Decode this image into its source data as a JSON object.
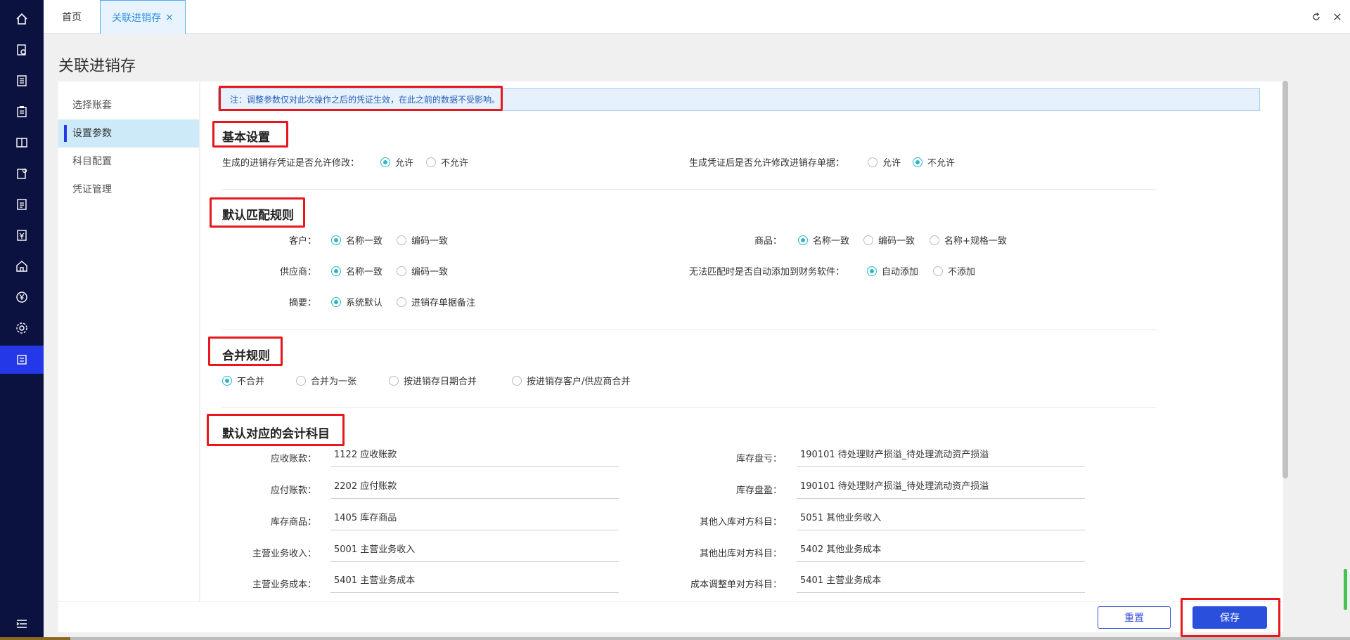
{
  "tabs": {
    "home": "首页",
    "active": "关联进销存",
    "active_close": "×"
  },
  "toolbar": {
    "refresh_icon": "refresh-icon",
    "close_icon": "close-icon"
  },
  "page": {
    "title": "关联进销存"
  },
  "sidebar_nav": {
    "items": [
      "选择账套",
      "设置参数",
      "科目配置",
      "凭证管理"
    ],
    "active_index": 1
  },
  "notice": "注：调整参数仅对此次操作之后的凭证生效，在此之前的数据不受影响。",
  "basic": {
    "title": "基本设置",
    "q1": {
      "label": "生成的进销存凭证是否允许修改：",
      "options": [
        "允许",
        "不允许"
      ],
      "selected": "允许"
    },
    "q2": {
      "label": "生成凭证后是否允许修改进销存单据：",
      "options": [
        "允许",
        "不允许"
      ],
      "selected": "不允许"
    }
  },
  "match": {
    "title": "默认匹配规则",
    "customer": {
      "label": "客户：",
      "options": [
        "名称一致",
        "编码一致"
      ],
      "selected": "名称一致"
    },
    "goods": {
      "label": "商品：",
      "options": [
        "名称一致",
        "编码一致",
        "名称+规格一致"
      ],
      "selected": "名称一致"
    },
    "supplier": {
      "label": "供应商：",
      "options": [
        "名称一致",
        "编码一致"
      ],
      "selected": "名称一致"
    },
    "auto_add": {
      "label": "无法匹配时是否自动添加到财务软件：",
      "options": [
        "自动添加",
        "不添加"
      ],
      "selected": "自动添加"
    },
    "summary": {
      "label": "摘要：",
      "options": [
        "系统默认",
        "进销存单据备注"
      ],
      "selected": "系统默认"
    }
  },
  "merge": {
    "title": "合并规则",
    "options": [
      "不合并",
      "合并为一张",
      "按进销存日期合并",
      "按进销存客户/供应商合并"
    ],
    "selected": "不合并"
  },
  "accounts": {
    "title": "默认对应的会计科目",
    "left": [
      {
        "label": "应收账款：",
        "value": "1122 应收账款"
      },
      {
        "label": "应付账款：",
        "value": "2202 应付账款"
      },
      {
        "label": "库存商品：",
        "value": "1405 库存商品"
      },
      {
        "label": "主营业务收入：",
        "value": "5001 主营业务收入"
      },
      {
        "label": "主营业务成本：",
        "value": "5401 主营业务成本"
      }
    ],
    "right": [
      {
        "label": "库存盘亏：",
        "value": "190101 待处理财产损溢_待处理流动资产损溢"
      },
      {
        "label": "库存盘盈：",
        "value": "190101 待处理财产损溢_待处理流动资产损溢"
      },
      {
        "label": "其他入库对方科目：",
        "value": "5051 其他业务收入"
      },
      {
        "label": "其他出库对方科目：",
        "value": "5402 其他业务成本"
      },
      {
        "label": "成本调整单对方科目：",
        "value": "5401 主营业务成本"
      }
    ]
  },
  "footer": {
    "reset": "重置",
    "save": "保存"
  },
  "colors": {
    "sidebar_bg": "#0c1240",
    "active_icon_bg": "#2438e8",
    "accent": "#2fb5c9",
    "primary_button": "#2a4fdc",
    "highlight_box": "#e8171b"
  }
}
